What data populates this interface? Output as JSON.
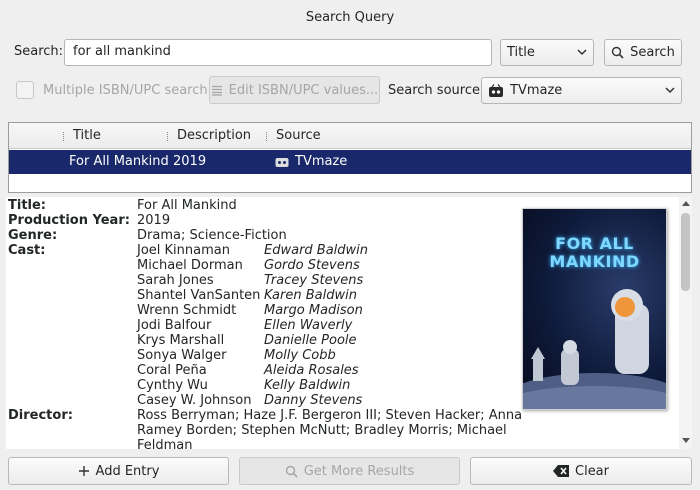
{
  "window": {
    "title": "Search Query"
  },
  "search": {
    "label": "Search:",
    "value": "for all mankind",
    "field_selected": "Title",
    "button_label": "Search"
  },
  "options": {
    "multi_isbn_label": "Multiple ISBN/UPC search",
    "edit_isbn_label": "Edit ISBN/UPC values...",
    "source_label": "Search source:",
    "source_selected": "TVmaze"
  },
  "results": {
    "columns": [
      "Title",
      "Description",
      "Source"
    ],
    "rows": [
      {
        "title": "For All Mankind",
        "description": "2019",
        "source": "TVmaze"
      }
    ]
  },
  "details": {
    "labels": {
      "title": "Title:",
      "year": "Production Year:",
      "genre": "Genre:",
      "cast": "Cast:",
      "director": "Director:"
    },
    "title": "For All Mankind",
    "year": "2019",
    "genre": "Drama; Science-Fiction",
    "cast": [
      {
        "actor": "Joel Kinnaman",
        "role": "Edward Baldwin"
      },
      {
        "actor": "Michael Dorman",
        "role": "Gordo Stevens"
      },
      {
        "actor": "Sarah Jones",
        "role": "Tracey Stevens"
      },
      {
        "actor": "Shantel VanSanten",
        "role": "Karen Baldwin"
      },
      {
        "actor": "Wrenn Schmidt",
        "role": "Margo Madison"
      },
      {
        "actor": "Jodi Balfour",
        "role": "Ellen Waverly"
      },
      {
        "actor": "Krys Marshall",
        "role": "Danielle Poole"
      },
      {
        "actor": "Sonya Walger",
        "role": "Molly Cobb"
      },
      {
        "actor": "Coral Peña",
        "role": "Aleida Rosales"
      },
      {
        "actor": "Cynthy Wu",
        "role": "Kelly Baldwin"
      },
      {
        "actor": "Casey W. Johnson",
        "role": "Danny Stevens"
      }
    ],
    "director_lines": [
      "Ross Berryman; Haze J.F. Bergeron III; Steven Hacker; Anna",
      "Ramey Borden; Stephen McNutt; Bradley Morris; Michael",
      "Feldman"
    ],
    "poster_text": "FOR ALL MANKIND"
  },
  "footer": {
    "add_entry": "Add Entry",
    "get_more": "Get More Results",
    "clear": "Clear"
  },
  "colors": {
    "selection": "#19286b",
    "poster_text": "#7fd8ff"
  },
  "icons": {
    "search": "magnifier-icon",
    "edit": "list-icon",
    "source": "tvmaze-icon",
    "add": "plus-icon",
    "clear": "clear-icon"
  }
}
